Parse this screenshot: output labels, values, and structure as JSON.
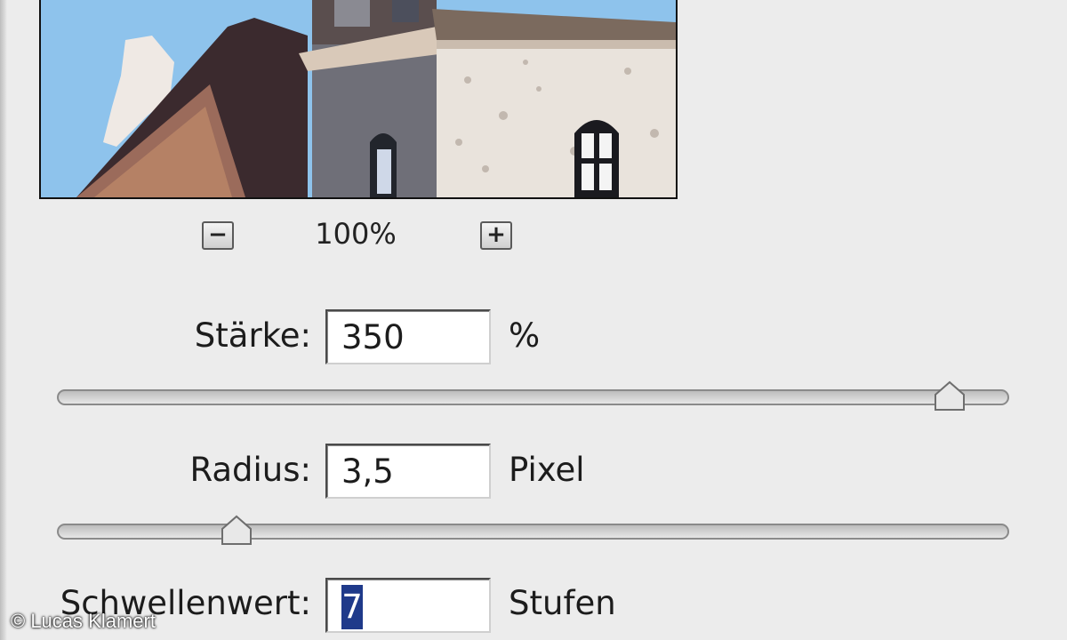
{
  "preview": {
    "zoom_level": "100%"
  },
  "controls": {
    "strength": {
      "label": "Stärke:",
      "value": "350",
      "unit": "%",
      "slider_fraction": 0.94
    },
    "radius": {
      "label": "Radius:",
      "value": "3,5",
      "unit": "Pixel",
      "slider_fraction": 0.19
    },
    "threshold": {
      "label": "Schwellenwert:",
      "value": "7",
      "unit": "Stufen"
    }
  },
  "icons": {
    "zoom_out": "minus-icon",
    "zoom_in": "plus-icon"
  },
  "colors": {
    "selection": "#1f3a8a",
    "background": "#ececec"
  },
  "copyright": "© Lucas Klamert"
}
